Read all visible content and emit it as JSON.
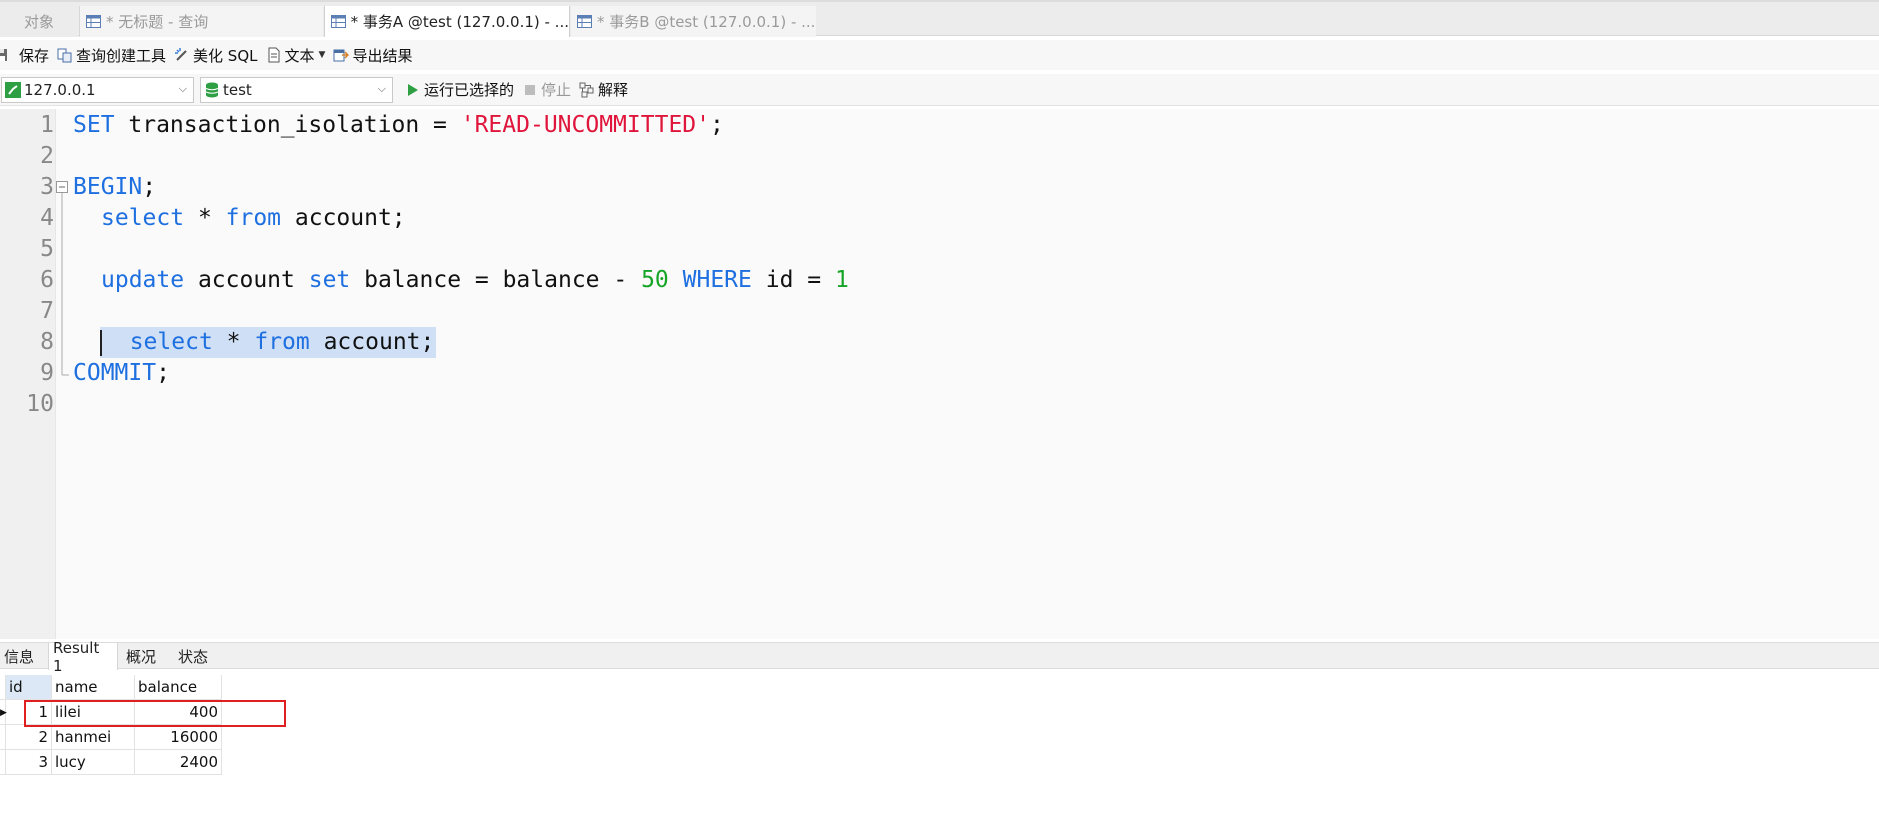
{
  "tabs": [
    {
      "label": "对象"
    },
    {
      "label": "* 无标题 - 查询"
    },
    {
      "label": "* 事务A @test (127.0.0.1) - ..."
    },
    {
      "label": "* 事务B @test (127.0.0.1) - ..."
    }
  ],
  "toolbar": {
    "save": "保存",
    "query_builder": "查询创建工具",
    "beautify": "美化 SQL",
    "text": "文本",
    "export": "导出结果"
  },
  "connection": {
    "host": "127.0.0.1",
    "database": "test",
    "run_selected": "运行已选择的",
    "stop": "停止",
    "explain": "解释"
  },
  "editor": {
    "line_numbers": [
      "1",
      "2",
      "3",
      "4",
      "5",
      "6",
      "7",
      "8",
      "9",
      "10"
    ],
    "lines": {
      "l1_kw": "SET",
      "l1_mid": " transaction_isolation = ",
      "l1_str": "'READ-UNCOMMITTED'",
      "l1_end": ";",
      "l3_kw": "BEGIN",
      "l3_end": ";",
      "l4_kw1": "select",
      "l4_mid": " * ",
      "l4_kw2": "from",
      "l4_end": " account;",
      "l6_kw1": "update",
      "l6_mid1": " account ",
      "l6_kw2": "set",
      "l6_mid2": " balance = balance - ",
      "l6_num1": "50",
      "l6_sp": " ",
      "l6_kw3": "WHERE",
      "l6_mid3": " id = ",
      "l6_num2": "1",
      "l8_kw1": "select",
      "l8_mid": " * ",
      "l8_kw2": "from",
      "l8_end": " account;",
      "l9_kw": "COMMIT",
      "l9_end": ";"
    }
  },
  "result_tabs": [
    "信息",
    "Result 1",
    "概况",
    "状态"
  ],
  "grid": {
    "columns": [
      "id",
      "name",
      "balance"
    ],
    "rows": [
      {
        "id": "1",
        "name": "lilei",
        "balance": "400"
      },
      {
        "id": "2",
        "name": "hanmei",
        "balance": "16000"
      },
      {
        "id": "3",
        "name": "lucy",
        "balance": "2400"
      }
    ]
  },
  "colors": {
    "keyword": "#1e6fe0",
    "string": "#e0153b",
    "number": "#17a528",
    "selection": "#cfe0f6",
    "highlight_box": "#e02020"
  }
}
